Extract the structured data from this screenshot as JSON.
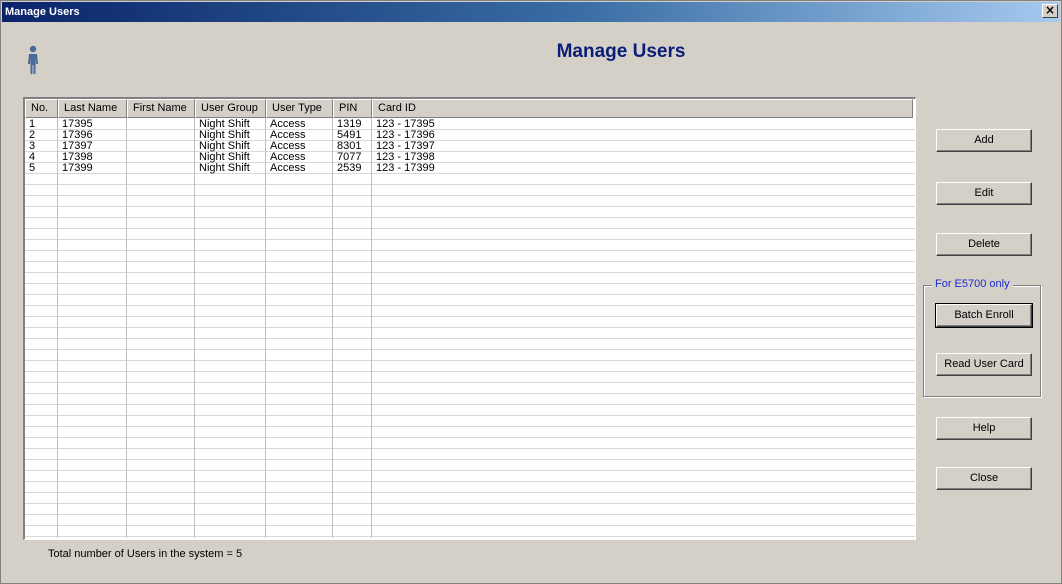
{
  "window": {
    "title": "Manage Users",
    "close_glyph": "×"
  },
  "header": {
    "title": "Manage Users",
    "icon": "person-icon"
  },
  "table": {
    "columns": [
      "No.",
      "Last Name",
      "First Name",
      "User Group",
      "User Type",
      "PIN",
      "Card ID"
    ],
    "rows": [
      [
        "1",
        "17395",
        "",
        "Night Shift",
        "Access",
        "1319",
        "123 - 17395"
      ],
      [
        "2",
        "17396",
        "",
        "Night Shift",
        "Access",
        "5491",
        "123 - 17396"
      ],
      [
        "3",
        "17397",
        "",
        "Night Shift",
        "Access",
        "8301",
        "123 - 17397"
      ],
      [
        "4",
        "17398",
        "",
        "Night Shift",
        "Access",
        "7077",
        "123 - 17398"
      ],
      [
        "5",
        "17399",
        "",
        "Night Shift",
        "Access",
        "2539",
        "123 - 17399"
      ]
    ]
  },
  "buttons": {
    "add": "Add",
    "edit": "Edit",
    "delete": "Delete",
    "batch_enroll": "Batch Enroll",
    "read_user_card": "Read User Card",
    "help": "Help",
    "close": "Close"
  },
  "group": {
    "label": "For E5700 only"
  },
  "status": {
    "total_text": "Total number of Users in the system =  5"
  },
  "colors": {
    "title_text": "#0a1e78",
    "group_label": "#1a2cc8",
    "face": "#d4d0c8"
  }
}
